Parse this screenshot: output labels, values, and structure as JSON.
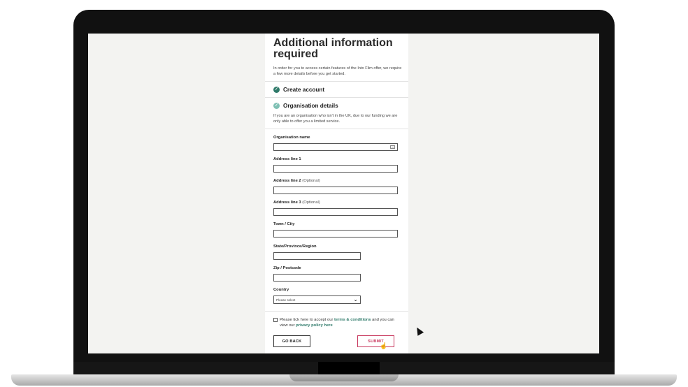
{
  "page": {
    "title": "Additional information required",
    "intro": "In order for you to access certain features of the Into Film offer, we require a few more details before you get started."
  },
  "steps": [
    {
      "label": "Create account",
      "state": "complete"
    },
    {
      "label": "Organisation details",
      "state": "current"
    }
  ],
  "org_note": "If you are an organisation who isn't in the UK, due to our funding we are only able to offer you a limited service.",
  "form": {
    "organisation_name": {
      "label": "Organisation name",
      "value": ""
    },
    "address_line_1": {
      "label": "Address line 1",
      "value": ""
    },
    "address_line_2": {
      "label": "Address line 2",
      "optional": "(Optional)",
      "value": ""
    },
    "address_line_3": {
      "label": "Address line 3",
      "optional": "(Optional)",
      "value": ""
    },
    "town_city": {
      "label": "Town / City",
      "value": ""
    },
    "state_region": {
      "label": "State/Province/Region",
      "value": ""
    },
    "zip_postcode": {
      "label": "Zip / Postcode",
      "value": ""
    },
    "country": {
      "label": "Country",
      "selected": "Please select"
    }
  },
  "terms": {
    "prefix": "Please tick here to accept our",
    "terms_link": "terms & conditions",
    "middle": "and you can view our",
    "privacy_link": "privacy policy here"
  },
  "buttons": {
    "back": "GO BACK",
    "submit": "SUBMIT"
  },
  "colors": {
    "accent_green": "#2f7a6a",
    "submit_red": "#c8385e"
  },
  "icons": {
    "step_complete": "check-circle-icon",
    "select": "chevron-down-icon",
    "field_autofill": "card-icon",
    "pointer": "hand-pointer-icon"
  }
}
